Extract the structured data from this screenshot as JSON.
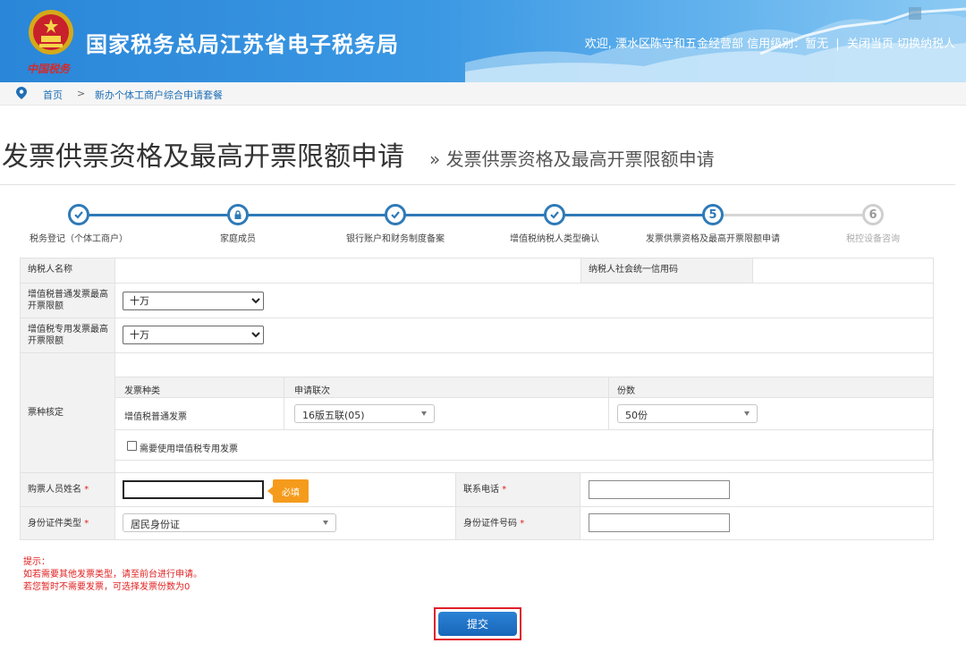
{
  "header": {
    "title": "国家税务总局江苏省电子税务局",
    "logo_text": "中国税务",
    "welcome": "欢迎, 溧水区陈守和五金经营部",
    "credit": "信用级别：暂无",
    "close_page": "关闭当页",
    "switch_taxpayer": "切换纳税人"
  },
  "breadcrumb": {
    "home": "首页",
    "sep": ">",
    "current": "新办个体工商户综合申请套餐"
  },
  "page": {
    "title": "发票供票资格及最高开票限额申请",
    "subtitle": "» 发票供票资格及最高开票限额申请"
  },
  "steps": [
    {
      "label": "税务登记（个体工商户）",
      "state": "done"
    },
    {
      "label": "家庭成员",
      "state": "locked"
    },
    {
      "label": "银行账户和财务制度备案",
      "state": "done"
    },
    {
      "label": "增值税纳税人类型确认",
      "state": "done"
    },
    {
      "num": "5",
      "label": "发票供票资格及最高开票限额申请",
      "state": "current"
    },
    {
      "num": "6",
      "label": "税控设备咨询",
      "state": "todo"
    }
  ],
  "form": {
    "taxpayer_name_label": "纳税人名称",
    "taxpayer_name_value": "",
    "credit_code_label": "纳税人社会统一信用码",
    "credit_code_value": "",
    "vat_normal_limit_label": "增值税普通发票最高开票限额",
    "vat_normal_limit_value": "十万",
    "vat_special_limit_label": "增值税专用发票最高开票限额",
    "vat_special_limit_value": "十万",
    "ticket_type_label": "票种核定",
    "ticket_table": {
      "headers": [
        "发票种类",
        "申请联次",
        "份数"
      ],
      "row": {
        "type": "增值税普通发票",
        "copies": "16版五联(05)",
        "count": "50份"
      }
    },
    "special_invoice_checkbox": "需要使用增值税专用发票",
    "buyer_name_label": "购票人员姓名",
    "buyer_name_value": "",
    "required_hint": "必填",
    "phone_label": "联系电话",
    "phone_value": "",
    "id_type_label": "身份证件类型",
    "id_type_value": "居民身份证",
    "id_number_label": "身份证件号码",
    "id_number_value": "",
    "required_mark": "*"
  },
  "tips": {
    "title": "提示：",
    "line1": "如若需要其他发票类型，请至前台进行申请。",
    "line2": "若您暂时不需要发票，可选择发票份数为0"
  },
  "submit_label": "提交"
}
